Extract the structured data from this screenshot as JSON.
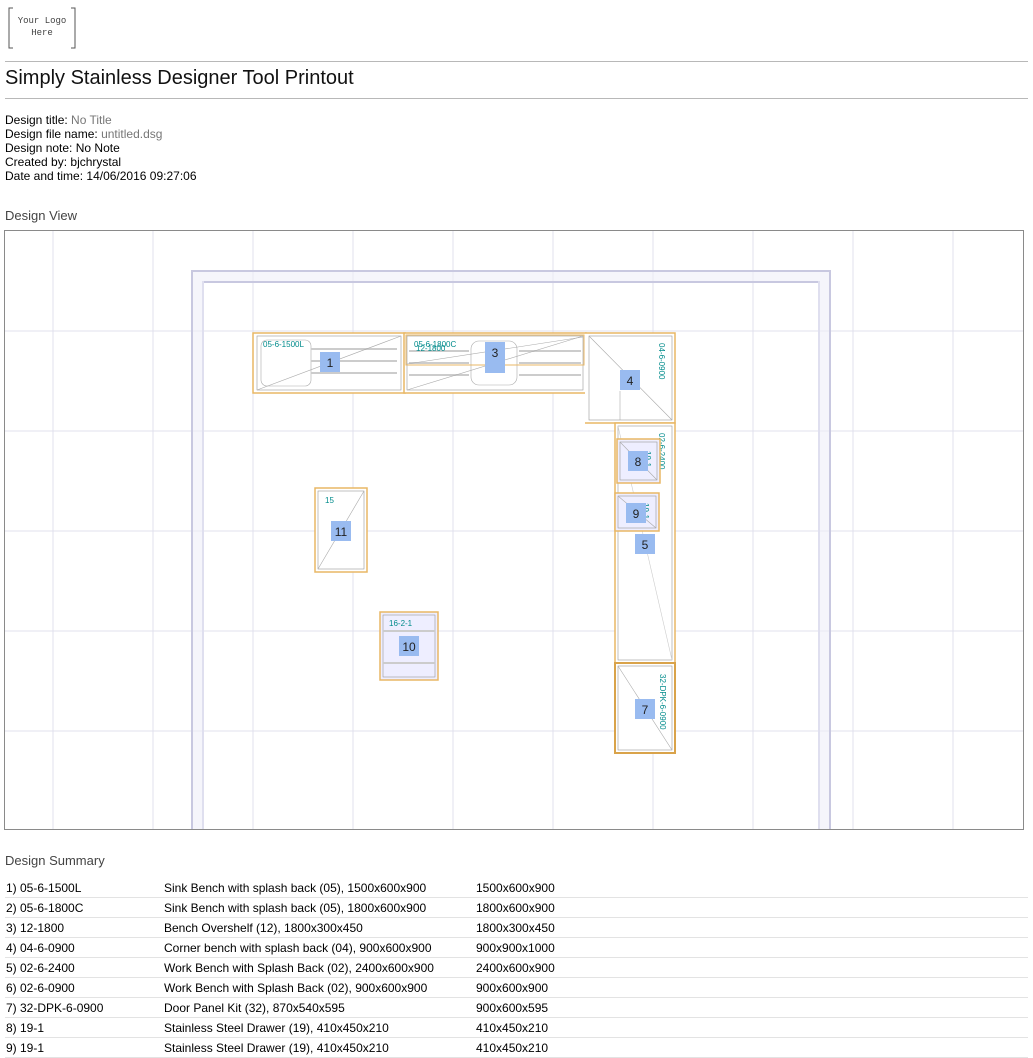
{
  "logo": {
    "line1": "Your Logo",
    "line2": "Here"
  },
  "page": {
    "title": "Simply Stainless Designer Tool Printout"
  },
  "info": {
    "title_label": "Design title:",
    "title_value": "No Title",
    "file_label": "Design file name:",
    "file_value": "untitled.dsg",
    "note_label": "Design note:",
    "note_value": "No Note",
    "created_label": "Created by:",
    "created_value": "bjchrystal",
    "date_label": "Date and time:",
    "date_value": "14/06/2016 09:27:06"
  },
  "design_view": {
    "heading": "Design View",
    "items": [
      {
        "number": "1",
        "code": "05-6-1500L"
      },
      {
        "number": "2",
        "code": "05-6-1800C"
      },
      {
        "number": "3",
        "code": "12-1800"
      },
      {
        "number": "4",
        "code": "04-6-0900"
      },
      {
        "number": "5",
        "code": "02-6-2400"
      },
      {
        "number": "7",
        "code": "32-DPK-6-0900"
      },
      {
        "number": "8",
        "code": "19-1"
      },
      {
        "number": "9",
        "code": "19-1"
      },
      {
        "number": "10",
        "code": "16-2-1"
      },
      {
        "number": "11",
        "code": "15"
      }
    ]
  },
  "summary": {
    "heading": "Design Summary",
    "rows": [
      {
        "item": "1) 05-6-1500L",
        "description": "Sink Bench with splash back (05), 1500x600x900",
        "size": "1500x600x900"
      },
      {
        "item": "2) 05-6-1800C",
        "description": "Sink Bench with splash back (05), 1800x600x900",
        "size": "1800x600x900"
      },
      {
        "item": "3) 12-1800",
        "description": "Bench Overshelf (12), 1800x300x450",
        "size": "1800x300x450"
      },
      {
        "item": "4) 04-6-0900",
        "description": "Corner bench with splash back (04), 900x600x900",
        "size": "900x900x1000"
      },
      {
        "item": "5) 02-6-2400",
        "description": "Work Bench with Splash Back (02), 2400x600x900",
        "size": "2400x600x900"
      },
      {
        "item": "6) 02-6-0900",
        "description": "Work Bench with Splash Back (02), 900x600x900",
        "size": "900x600x900"
      },
      {
        "item": "7) 32-DPK-6-0900",
        "description": "Door Panel Kit (32), 870x540x595",
        "size": "900x600x595"
      },
      {
        "item": "8) 19-1",
        "description": "Stainless Steel Drawer (19), 410x450x210",
        "size": "410x450x210"
      },
      {
        "item": "9) 19-1",
        "description": "Stainless Steel Drawer (19), 410x450x210",
        "size": "410x450x210"
      }
    ]
  }
}
